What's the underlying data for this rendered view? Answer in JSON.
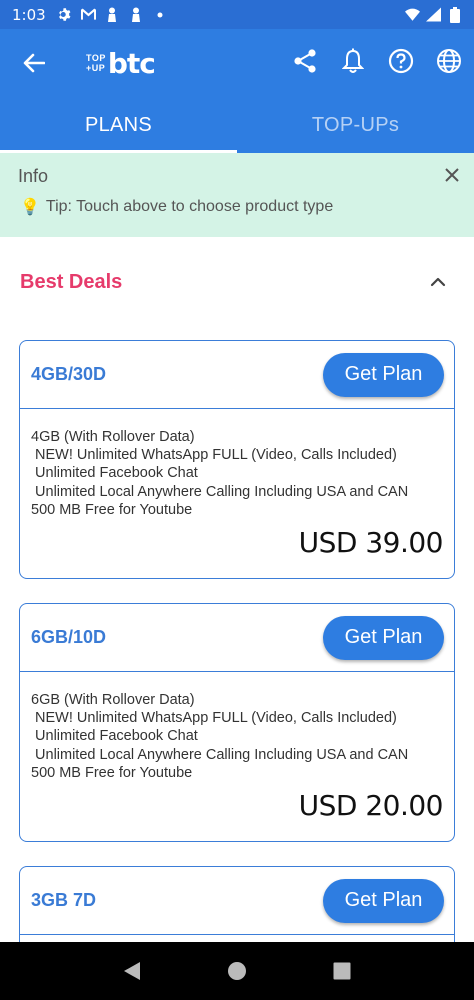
{
  "status_bar": {
    "time": "1:03",
    "icons": [
      "gear-icon",
      "gmail-icon",
      "person-icon",
      "person-icon",
      "dot-icon"
    ],
    "right_icons": [
      "wifi-icon",
      "signal-icon",
      "battery-icon"
    ]
  },
  "app_bar": {
    "logo_top": "TOP",
    "logo_up": "+UP",
    "logo_brand": "btc",
    "actions": [
      "share-icon",
      "bell-icon",
      "help-icon",
      "globe-icon"
    ]
  },
  "tabs": [
    {
      "label": "PLANS",
      "active": true
    },
    {
      "label": "TOP-UPs",
      "active": false
    }
  ],
  "info": {
    "title": "Info",
    "tip_icon": "💡",
    "tip": "Tip: Touch above to choose product type"
  },
  "section": {
    "title": "Best Deals"
  },
  "colors": {
    "primary": "#2e7de1",
    "accent_pink": "#e63b6b",
    "info_bg": "#d4f3e6",
    "card_border": "#3b7dd8"
  },
  "plans": [
    {
      "name": "4GB/30D",
      "button": "Get Plan",
      "lines": [
        "4GB (With Rollover Data)",
        " NEW! Unlimited WhatsApp FULL (Video, Calls Included)",
        " Unlimited Facebook Chat",
        " Unlimited Local Anywhere Calling Including USA and CAN",
        "500 MB Free for Youtube"
      ],
      "price": "USD 39.00"
    },
    {
      "name": "6GB/10D",
      "button": "Get Plan",
      "lines": [
        "6GB (With Rollover Data)",
        " NEW! Unlimited WhatsApp FULL (Video, Calls Included)",
        " Unlimited Facebook Chat",
        " Unlimited Local Anywhere Calling Including USA and CAN",
        "500 MB Free for Youtube"
      ],
      "price": "USD 20.00"
    },
    {
      "name": "3GB 7D",
      "button": "Get Plan"
    }
  ]
}
